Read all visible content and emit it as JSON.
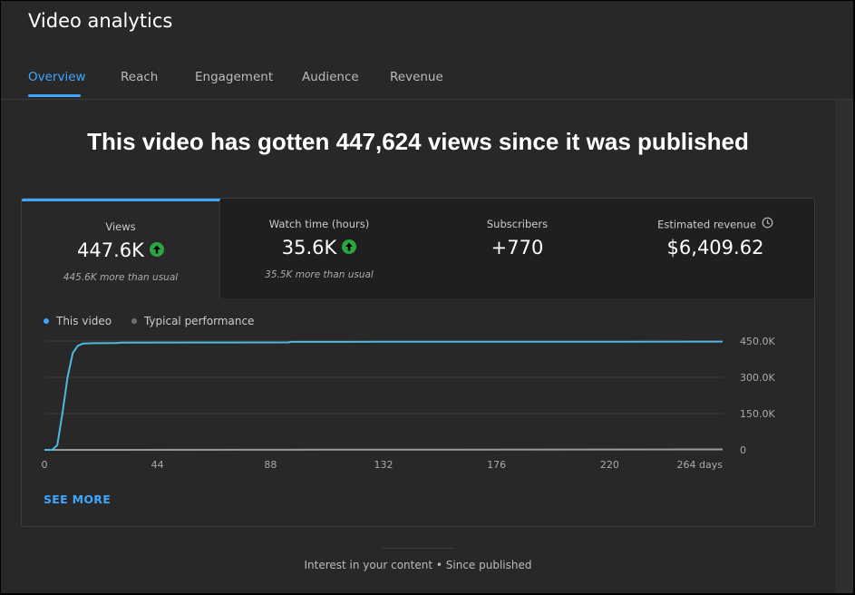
{
  "header": {
    "title": "Video analytics"
  },
  "tabs": [
    {
      "label": "Overview",
      "active": true
    },
    {
      "label": "Reach"
    },
    {
      "label": "Engagement"
    },
    {
      "label": "Audience"
    },
    {
      "label": "Revenue"
    }
  ],
  "headline": "This video has gotten 447,624 views since it was published",
  "metrics": [
    {
      "label": "Views",
      "value": "447.6K",
      "trend": "up",
      "note": "445.6K more than usual"
    },
    {
      "label": "Watch time (hours)",
      "value": "35.6K",
      "trend": "up",
      "note": "35.5K more than usual"
    },
    {
      "label": "Subscribers",
      "value": "+770"
    },
    {
      "label": "Estimated revenue",
      "value": "$6,409.62",
      "icon": "clock-icon"
    }
  ],
  "legend": [
    {
      "label": "This video",
      "color": "#3ea6ff"
    },
    {
      "label": "Typical performance",
      "color": "#717171"
    }
  ],
  "see_more": "SEE MORE",
  "footer": "Interest in your content • Since published",
  "chart_data": {
    "type": "line",
    "x_ticks": [
      "0",
      "44",
      "88",
      "132",
      "176",
      "220",
      "264 days"
    ],
    "y_ticks": [
      "0",
      "150.0K",
      "300.0K",
      "450.0K"
    ],
    "xlim": [
      0,
      264
    ],
    "ylim": [
      0,
      450000
    ],
    "series": [
      {
        "name": "This video",
        "color": "#4fb8e0",
        "x": [
          0,
          3,
          5,
          7,
          9,
          11,
          13,
          15,
          20,
          28,
          30,
          60,
          95,
          96,
          130,
          180,
          220,
          264
        ],
        "y": [
          0,
          0,
          20000,
          150000,
          300000,
          400000,
          430000,
          440000,
          441000,
          441500,
          443500,
          444000,
          444500,
          446500,
          447000,
          447300,
          447500,
          447624
        ]
      },
      {
        "name": "Typical performance",
        "color": "#9a9a9a",
        "x": [
          0,
          3,
          264
        ],
        "y": [
          0,
          0,
          2000
        ]
      }
    ]
  }
}
